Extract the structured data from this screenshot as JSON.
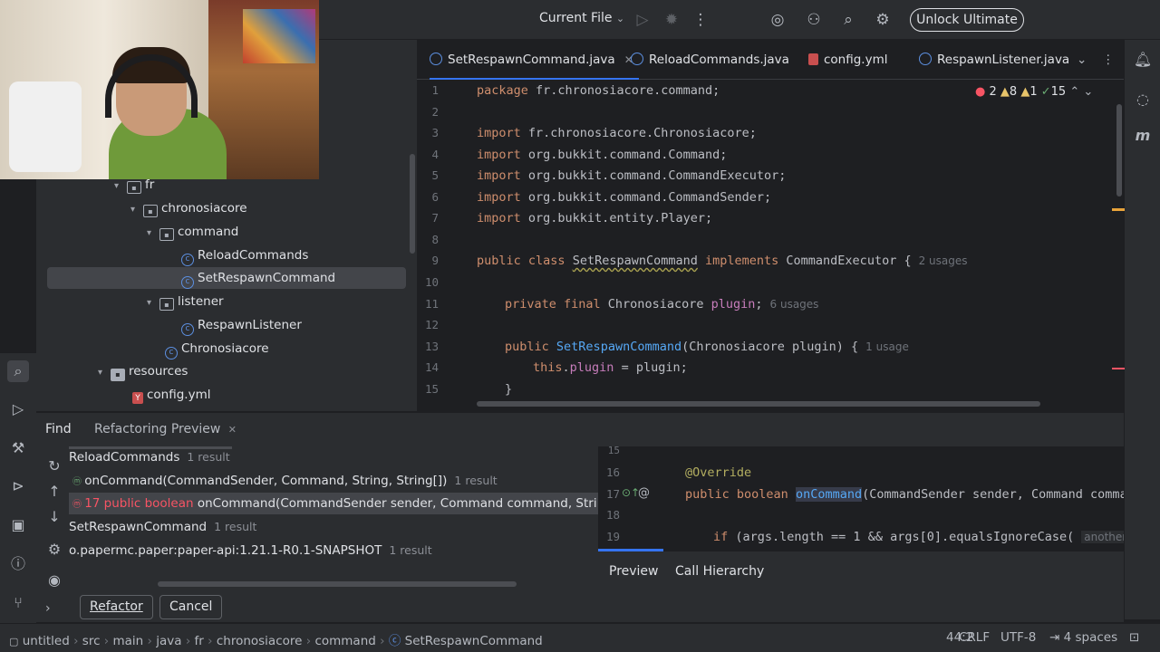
{
  "titlebar": {
    "run_config": "Current File",
    "run_config_icon": "chevron-down-icon",
    "unlock_label": "Unlock Ultimate"
  },
  "project_tree": {
    "items": [
      {
        "label": "fr",
        "icon": "package-icon"
      },
      {
        "label": "chronosiacore",
        "icon": "package-icon"
      },
      {
        "label": "command",
        "icon": "package-icon"
      },
      {
        "label": "ReloadCommands",
        "icon": "class-icon"
      },
      {
        "label": "SetRespawnCommand",
        "icon": "class-icon",
        "selected": true
      },
      {
        "label": "listener",
        "icon": "package-icon"
      },
      {
        "label": "RespawnListener",
        "icon": "class-icon"
      },
      {
        "label": "Chronosiacore",
        "icon": "class-icon"
      },
      {
        "label": "resources",
        "icon": "folder-icon"
      },
      {
        "label": "config.yml",
        "icon": "yaml-icon"
      }
    ]
  },
  "editor": {
    "tabs": [
      {
        "label": "SetRespawnCommand.java",
        "active": true
      },
      {
        "label": "ReloadCommands.java"
      },
      {
        "label": "config.yml"
      },
      {
        "label": "RespawnListener.java"
      }
    ],
    "inspections": {
      "errors": "2",
      "warnings": "8",
      "weak": "1",
      "typos": "15"
    },
    "lines": {
      "l1": {
        "n": "1",
        "kw": "package",
        "rest": " fr.chronosiacore.command;"
      },
      "l2": {
        "n": "2"
      },
      "l3": {
        "n": "3",
        "kw": "import",
        "rest": " fr.chronosiacore.Chronosiacore;"
      },
      "l4": {
        "n": "4",
        "kw": "import",
        "rest": " org.bukkit.command.Command;"
      },
      "l5": {
        "n": "5",
        "kw": "import",
        "rest": " org.bukkit.command.CommandExecutor;"
      },
      "l6": {
        "n": "6",
        "kw": "import",
        "rest": " org.bukkit.command.CommandSender;"
      },
      "l7": {
        "n": "7",
        "kw": "import",
        "rest": " org.bukkit.entity.Player;"
      },
      "l8": {
        "n": "8"
      },
      "l9": {
        "n": "9",
        "kw1": "public class",
        "name": "SetRespawnCommand",
        "kw2": "implements",
        "rest": " CommandExecutor {",
        "hint": "2 usages"
      },
      "l10": {
        "n": "10"
      },
      "l11": {
        "n": "11",
        "kw": "private final",
        "type": " Chronosiacore ",
        "field": "plugin",
        "rest": ";",
        "hint": "6 usages"
      },
      "l12": {
        "n": "12"
      },
      "l13": {
        "n": "13",
        "kw": "public",
        "fn": "SetRespawnCommand",
        "rest": "(Chronosiacore plugin) {",
        "hint": "1 usage"
      },
      "l14": {
        "n": "14",
        "kw": "this",
        "field": "plugin",
        "rest": " = plugin;"
      },
      "l15": {
        "n": "15",
        "rest": "}"
      }
    }
  },
  "bottom_panel": {
    "tabs": {
      "find": "Find",
      "refactoring_preview": "Refactoring Preview"
    },
    "results": {
      "r1": {
        "label": "ReloadCommands",
        "count": "1 result"
      },
      "r2": {
        "label": "onCommand(CommandSender, Command, String, String[])",
        "count": "1 result"
      },
      "r3": {
        "line": "17",
        "text": "public boolean",
        "rest": "onCommand(CommandSender sender, Command command, String label, St"
      },
      "r4": {
        "label": "SetRespawnCommand",
        "count": "1 result"
      },
      "r5": {
        "label": "o.papermc.paper:paper-api:1.21.1-R0.1-SNAPSHOT",
        "count": "1 result"
      }
    },
    "preview": {
      "p15": {
        "n": "15"
      },
      "p16": {
        "n": "16",
        "ann": "@Override"
      },
      "p17": {
        "n": "17",
        "kw": "public boolean",
        "fn": "onCommand",
        "rest": "(CommandSender sender, Command command,"
      },
      "p18": {
        "n": "18"
      },
      "p19": {
        "n": "19",
        "kw": "if",
        "rest": " (args.length == 1 && args[0].equalsIgnoreCase(",
        "hint": "anotherStrin"
      }
    },
    "preview_tabs": {
      "preview": "Preview",
      "call_hierarchy": "Call Hierarchy"
    },
    "buttons": {
      "refactor": "Refactor",
      "cancel": "Cancel"
    }
  },
  "statusbar": {
    "crumbs": [
      "untitled",
      "src",
      "main",
      "java",
      "fr",
      "chronosiacore",
      "command",
      "SetRespawnCommand"
    ],
    "position": "44:2",
    "line_ending": "CRLF",
    "encoding": "UTF-8",
    "indent": "4 spaces"
  }
}
